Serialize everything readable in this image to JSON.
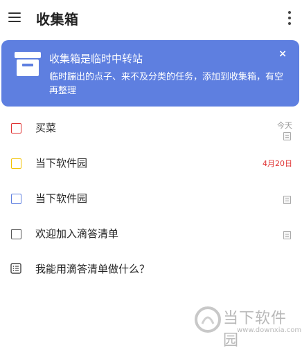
{
  "header": {
    "title": "收集箱",
    "menu_icon": "hamburger-menu-icon",
    "more_icon": "more-vertical-icon"
  },
  "banner": {
    "title": "收集箱是临时中转站",
    "description": "临时蹦出的点子、来不及分类的任务，添加到收集箱，有空再整理",
    "close_label": "×",
    "icon": "inbox-tray-icon",
    "color": "#5e7fe0"
  },
  "tasks": [
    {
      "title": "买菜",
      "date": "今天",
      "checkbox_color": "#e03131",
      "has_note": true
    },
    {
      "title": "当下软件园",
      "date": "4月20日",
      "checkbox_color": "#f2c200",
      "has_note": false
    },
    {
      "title": "当下软件园",
      "date": "",
      "checkbox_color": "#5e7fe0",
      "has_note": true
    },
    {
      "title": "欢迎加入滴答清单",
      "date": "",
      "checkbox_color": "#555555",
      "has_note": true
    },
    {
      "title": "我能用滴答清单做什么？",
      "date": "",
      "icon": "document-list-icon"
    }
  ],
  "watermark": {
    "name": "当下软件园",
    "url": "www.downxia.com"
  }
}
